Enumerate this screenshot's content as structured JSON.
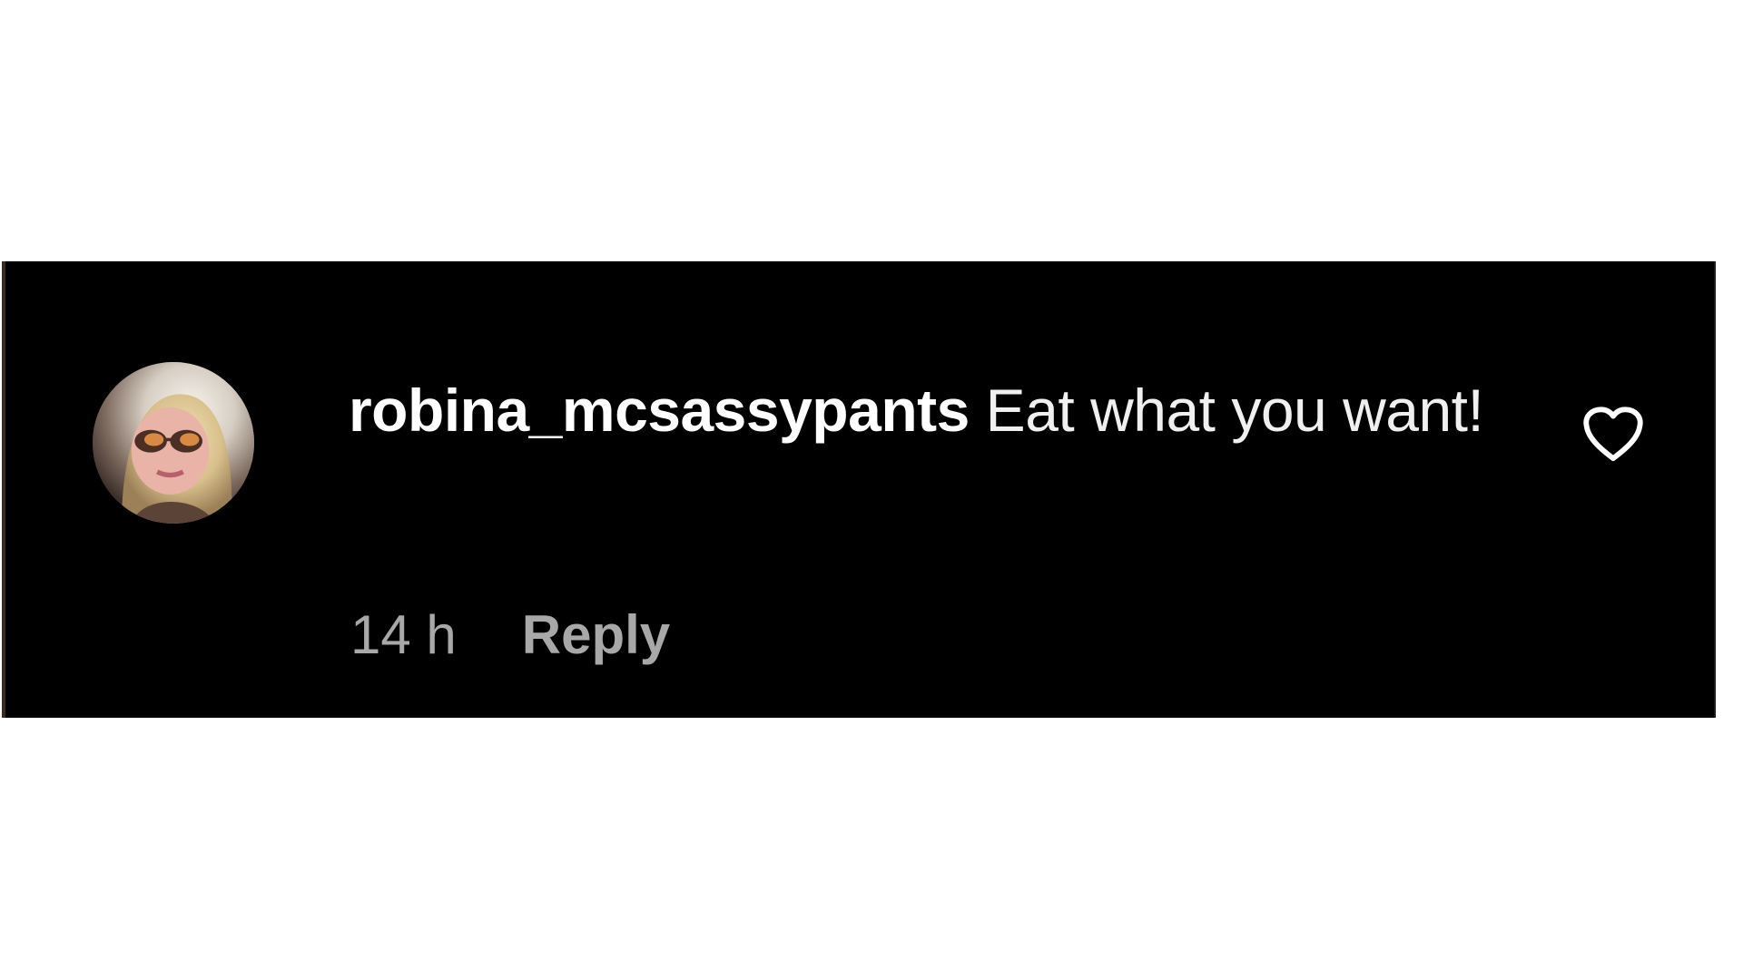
{
  "comment": {
    "username": "robina_mcsassypants",
    "text": "Eat what you want!",
    "time": "14 h",
    "reply_label": "Reply",
    "avatar_icon": "user-avatar",
    "like_icon": "heart-outline-icon"
  },
  "colors": {
    "panel_background": "#000000",
    "text": "#ffffff",
    "meta_text": "#a8a8a8"
  }
}
